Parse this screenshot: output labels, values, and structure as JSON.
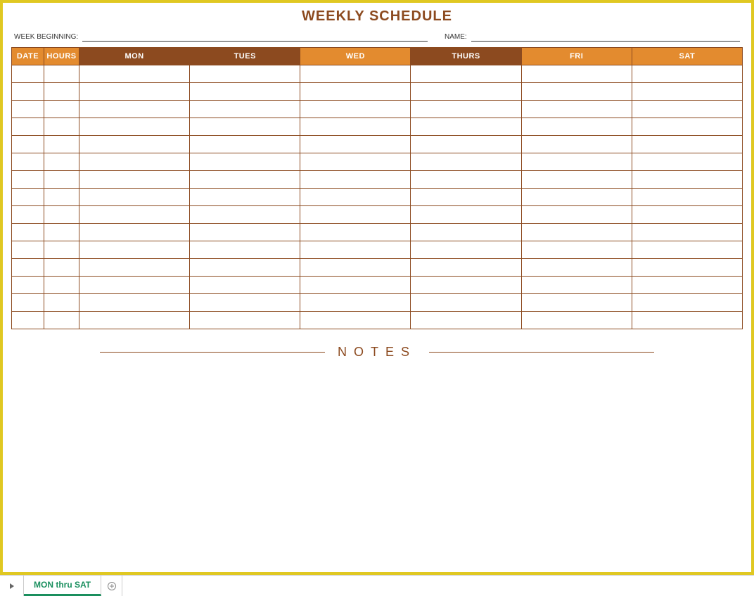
{
  "title": "WEEKLY SCHEDULE",
  "meta": {
    "week_beginning_label": "WEEK BEGINNING:",
    "week_beginning_value": "",
    "name_label": "NAME:",
    "name_value": ""
  },
  "headers": {
    "date": "DATE",
    "hours": "HOURS",
    "days": [
      "MON",
      "TUES",
      "WED",
      "THURS",
      "FRI",
      "SAT"
    ]
  },
  "rows": [
    {
      "date": "",
      "hours": "",
      "mon": "",
      "tues": "",
      "wed": "",
      "thurs": "",
      "fri": "",
      "sat": ""
    },
    {
      "date": "",
      "hours": "",
      "mon": "",
      "tues": "",
      "wed": "",
      "thurs": "",
      "fri": "",
      "sat": ""
    },
    {
      "date": "",
      "hours": "",
      "mon": "",
      "tues": "",
      "wed": "",
      "thurs": "",
      "fri": "",
      "sat": ""
    },
    {
      "date": "",
      "hours": "",
      "mon": "",
      "tues": "",
      "wed": "",
      "thurs": "",
      "fri": "",
      "sat": ""
    },
    {
      "date": "",
      "hours": "",
      "mon": "",
      "tues": "",
      "wed": "",
      "thurs": "",
      "fri": "",
      "sat": ""
    },
    {
      "date": "",
      "hours": "",
      "mon": "",
      "tues": "",
      "wed": "",
      "thurs": "",
      "fri": "",
      "sat": ""
    },
    {
      "date": "",
      "hours": "",
      "mon": "",
      "tues": "",
      "wed": "",
      "thurs": "",
      "fri": "",
      "sat": ""
    },
    {
      "date": "",
      "hours": "",
      "mon": "",
      "tues": "",
      "wed": "",
      "thurs": "",
      "fri": "",
      "sat": ""
    },
    {
      "date": "",
      "hours": "",
      "mon": "",
      "tues": "",
      "wed": "",
      "thurs": "",
      "fri": "",
      "sat": ""
    },
    {
      "date": "",
      "hours": "",
      "mon": "",
      "tues": "",
      "wed": "",
      "thurs": "",
      "fri": "",
      "sat": ""
    },
    {
      "date": "",
      "hours": "",
      "mon": "",
      "tues": "",
      "wed": "",
      "thurs": "",
      "fri": "",
      "sat": ""
    },
    {
      "date": "",
      "hours": "",
      "mon": "",
      "tues": "",
      "wed": "",
      "thurs": "",
      "fri": "",
      "sat": ""
    },
    {
      "date": "",
      "hours": "",
      "mon": "",
      "tues": "",
      "wed": "",
      "thurs": "",
      "fri": "",
      "sat": ""
    },
    {
      "date": "",
      "hours": "",
      "mon": "",
      "tues": "",
      "wed": "",
      "thurs": "",
      "fri": "",
      "sat": ""
    },
    {
      "date": "",
      "hours": "",
      "mon": "",
      "tues": "",
      "wed": "",
      "thurs": "",
      "fri": "",
      "sat": ""
    }
  ],
  "notes_label": "NOTES",
  "tabs": {
    "active": "MON thru SAT"
  }
}
